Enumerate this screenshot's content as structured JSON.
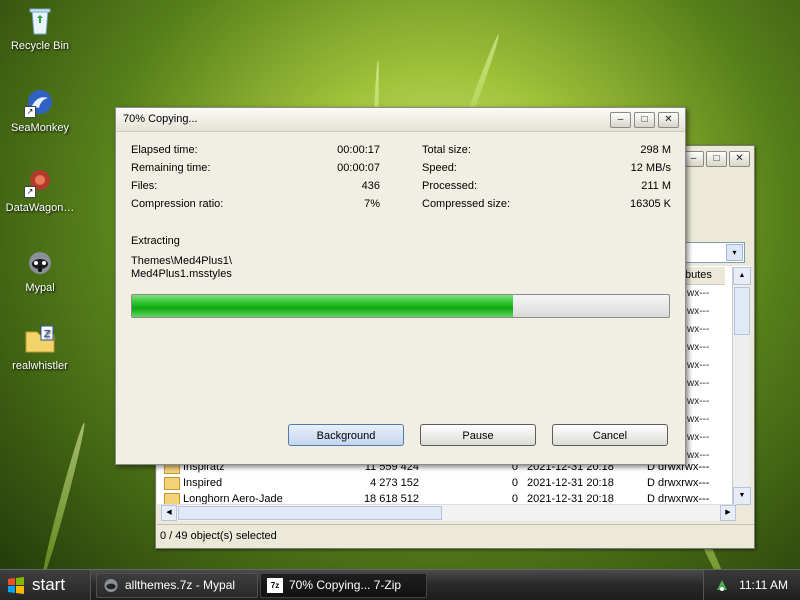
{
  "desktop": {
    "icons": [
      {
        "label": "Recycle Bin",
        "icon": "recycle-bin-icon"
      },
      {
        "label": "SeaMonkey",
        "icon": "seamonkey-icon"
      },
      {
        "label": "DataWagon…",
        "icon": "datawagon-icon"
      },
      {
        "label": "Mypal",
        "icon": "mypal-icon"
      },
      {
        "label": "realwhistler",
        "icon": "zip-folder-icon"
      }
    ]
  },
  "background_window": {
    "combo_arrow": "▾",
    "column_header_attributes": "butes",
    "permissions_column": [
      "wx---",
      "wx---",
      "wx---",
      "wx---",
      "wx---",
      "wx---",
      "wx---",
      "wx---",
      "wx---",
      "wx---"
    ],
    "rows": [
      {
        "name": "Inspiratz",
        "size": "11 559 424",
        "packed": "0",
        "modified": "2021-12-31 20:18",
        "attributes": "D drwxrwx---"
      },
      {
        "name": "Inspired",
        "size": "4 273 152",
        "packed": "0",
        "modified": "2021-12-31 20:18",
        "attributes": "D drwxrwx---"
      },
      {
        "name": "Longhorn Aero-Jade",
        "size": "18 618 512",
        "packed": "0",
        "modified": "2021-12-31 20:18",
        "attributes": "D drwxrwx---"
      }
    ],
    "status": "0 / 49 object(s) selected"
  },
  "dialog": {
    "title": "70% Copying...",
    "stats_left": [
      {
        "label": "Elapsed time:",
        "value": "00:00:17"
      },
      {
        "label": "Remaining time:",
        "value": "00:00:07"
      },
      {
        "label": "Files:",
        "value": "436"
      },
      {
        "label": "Compression ratio:",
        "value": "7%"
      }
    ],
    "stats_right": [
      {
        "label": "Total size:",
        "value": "298 M"
      },
      {
        "label": "Speed:",
        "value": "12 MB/s"
      },
      {
        "label": "Processed:",
        "value": "211 M"
      },
      {
        "label": "Compressed size:",
        "value": "16305 K"
      }
    ],
    "operation": "Extracting",
    "current_path": "Themes\\Med4Plus1\\",
    "current_file": "Med4Plus1.msstyles",
    "progress_fraction": 0.71,
    "buttons": {
      "background": "Background",
      "pause": "Pause",
      "cancel": "Cancel"
    }
  },
  "taskbar": {
    "start_label": "start",
    "tasks": [
      {
        "label": "allthemes.7z - Mypal",
        "icon": "mypal-icon"
      },
      {
        "label": "70% Copying... 7-Zip",
        "icon": "7zip-icon",
        "icon_text": "7z"
      }
    ],
    "clock": "11:11 AM"
  },
  "window_controls": {
    "minimize": "–",
    "maximize": "□",
    "close": "✕"
  }
}
